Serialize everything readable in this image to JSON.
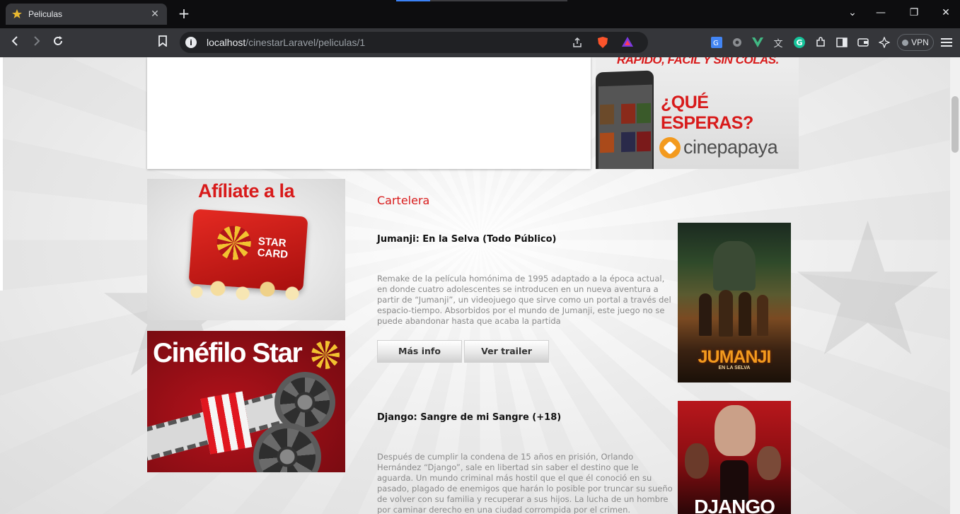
{
  "browser": {
    "tab_title": "Peliculas",
    "url_host": "localhost",
    "url_path": "/cinestarLaravel/peliculas/1",
    "vpn_label": "VPN",
    "new_tab_symbol": "+",
    "close_symbol": "✕",
    "window_controls": [
      "⌄",
      "—",
      "❐",
      "✕"
    ]
  },
  "ads": {
    "cinepapaya_tagline": "RAPIDO, FACIL Y SIN COLAS.",
    "cinepapaya_question": "¿QUÉ ESPERAS?",
    "cinepapaya_brand": "cinepapaya",
    "starcard_title": "Afíliate a la",
    "starcard_card_label_1": "STAR",
    "starcard_card_label_2": "CARD",
    "cinefilo_title": "Cinéfilo Star"
  },
  "main": {
    "section_title": "Cartelera",
    "movies": [
      {
        "title": "Jumanji: En la Selva (Todo Público)",
        "description": "Remake de la película homónima de 1995 adaptado a la época actual, en donde cuatro adolescentes se introducen en un nueva aventura a partir de “Jumanji”, un videojuego que sirve como un portal a través del espacio-tiempo. Absorbidos por el mundo de Jumanji, este juego no se puede abandonar hasta que acaba la partida",
        "more_info_label": "Más info",
        "trailer_label": "Ver trailer",
        "poster_text": "JUMANJI",
        "poster_subtext": "EN LA SELVA"
      },
      {
        "title": "Django: Sangre de mi Sangre (+18)",
        "description": "Después de cumplir la condena de 15 años en prisión, Orlando Hernández “Django”, sale en libertad sin saber el destino que le aguarda. Un mundo criminal más hostil que el que él conoció en su pasado, plagado de enemigos que harán lo posible por truncar su sueño de volver con su familia y recuperar a sus hijos. La lucha de un hombre por caminar derecho en una ciudad corrompida por el crimen.",
        "poster_text": "DJANGO"
      }
    ]
  },
  "colors": {
    "accent_red": "#d81a1a",
    "chrome_dark": "#35363a"
  }
}
